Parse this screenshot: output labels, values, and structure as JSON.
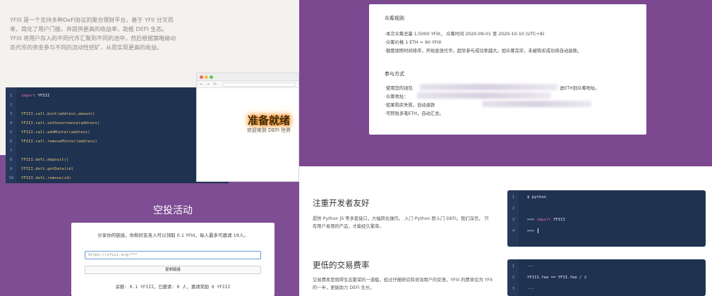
{
  "intro": {
    "text": "YFIII 是一个支持多种DeFi协议的聚合理财平台，基于 YFII 分叉而来，简化了用户门槛，并提供更高的收益率，助推 DEFI 生态。YFIII 将用户存入的不同代币汇聚到不同的池中，然后根据策略做动态代币的资金参与不同的流动性挖矿，从而实现更高的收益。"
  },
  "editor": {
    "lines": [
      {
        "n": "1",
        "kw": "import",
        "rest": " YFIII"
      },
      {
        "n": "2",
        "kw": "",
        "rest": ""
      },
      {
        "n": "3",
        "kw": "",
        "rest": "YFIII.call.mint(address,amount)"
      },
      {
        "n": "4",
        "kw": "",
        "rest": "YFIII.call.setGovernance(address)"
      },
      {
        "n": "5",
        "kw": "",
        "rest": "YFIII.call.addMinter(address)"
      },
      {
        "n": "6",
        "kw": "",
        "rest": "YFIII.call.removeMinter(address)"
      },
      {
        "n": "7",
        "kw": "",
        "rest": ""
      },
      {
        "n": "8",
        "kw": "",
        "rest": "YFIII.defi.deposit()"
      },
      {
        "n": "9",
        "kw": "",
        "rest": "YFIII.defi.getData(id)"
      },
      {
        "n": "10",
        "kw": "",
        "rest": "YFIII.defi.remove(id)"
      }
    ]
  },
  "browser": {
    "hero_title": "准备就绪",
    "hero_subtitle": "欢迎来到 DEFI 世界"
  },
  "airdrop": {
    "title": "空投活动",
    "description": "分享你的链接，你和好友各入可以领取 0.1 YFIII，每人最多可邀请 19人。",
    "input_value": "https://yfiii.org/***",
    "button_label": "复制链接",
    "stats": "余额: 0.1 YFIII，已邀请: 0 人，邀请奖励 0 YFIII"
  },
  "crowdfunding": {
    "rules_heading": "众筹规则",
    "rules": [
      "·本次众筹总量 1,5000 YFIII， 众筹时间 2020-09-01 至 2020-10-10 (UTC+8)",
      "·众筹价格 1 ETH = 90 YFIII",
      "·额度按照时间排序，开始发放代币，超早参与成功率越大。如众筹完毕，未被购买成功将自动退款。"
    ],
    "participate_heading": "参与方式",
    "steps": [
      "·使用您的钱包",
      "送ETH到众筹地址。",
      "·众筹地址：",
      "·如果购买失败，自动退款",
      "·可转账多笔ETH，自动汇总。"
    ]
  },
  "features": [
    {
      "title": "注重开发者友好",
      "desc": "提供 Python JS 等多套接口，大幅简化操作。 入门 Python 即入门 DEFI。我们深信， 只有用户易用的产品，才能经久繁荣。"
    },
    {
      "title": "更低的交易费率",
      "desc": "交易费率是阻碍生态繁荣的一道槛，经过仔细研究和咨询用户的反馈，YFIII 的费率仅为 YFII 的一半，更能助力 DEFI 生长。"
    }
  ],
  "terminal1": {
    "lines": [
      {
        "n": "1",
        "kw": "",
        "rest": "$ python"
      },
      {
        "n": "2",
        "kw": "",
        "rest": ""
      },
      {
        "n": "3",
        "kw": "import",
        "pre": ">>> ",
        "rest": " YFIII"
      },
      {
        "n": "4",
        "kw": "",
        "rest": ">>> "
      }
    ]
  },
  "terminal2": {
    "lines": [
      {
        "n": "1",
        "kw": "",
        "rest": "---"
      },
      {
        "n": "2",
        "kw": "",
        "rest": "YFIII.fee == YFII.fee / 2"
      },
      {
        "n": "3",
        "kw": "",
        "rest": "---"
      }
    ]
  },
  "colors": {
    "purple": "#7e4d93",
    "editor_bg": "#1f3250",
    "keyword": "#e86aa4",
    "method": "#e2c27a"
  }
}
